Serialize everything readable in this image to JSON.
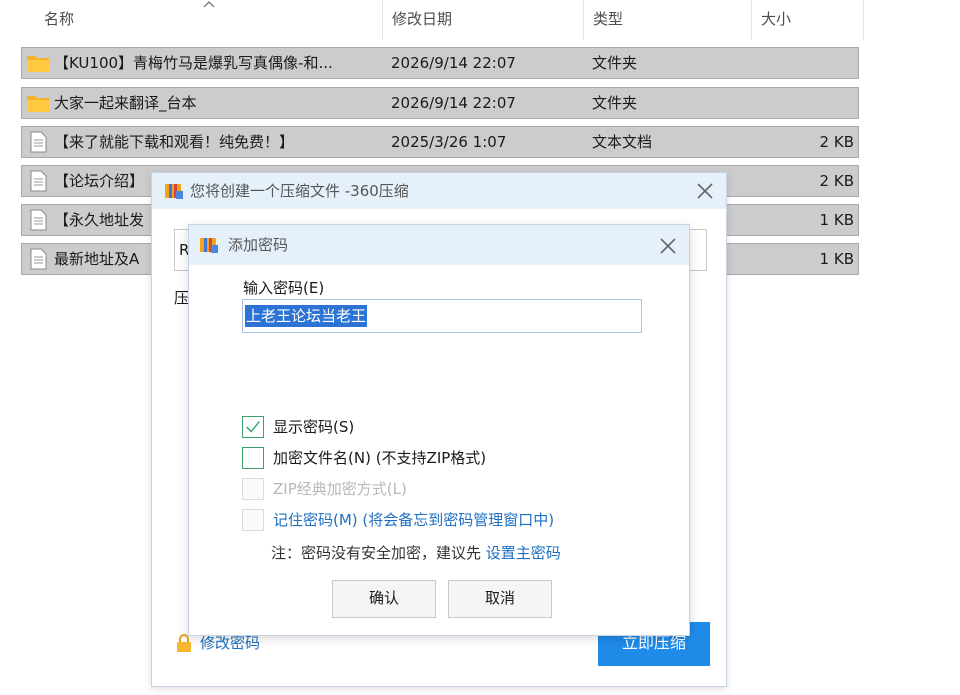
{
  "explorer": {
    "columns": [
      {
        "label": "名称"
      },
      {
        "label": "修改日期"
      },
      {
        "label": "类型"
      },
      {
        "label": "大小"
      }
    ],
    "rows": [
      {
        "icon": "folder-icon",
        "name": "【KU100】青梅竹马是爆乳写真偶像-和...",
        "date": "2026/9/14 22:07",
        "type": "文件夹",
        "size": ""
      },
      {
        "icon": "folder-icon",
        "name": "大家一起来翻译_台本",
        "date": "2026/9/14 22:07",
        "type": "文件夹",
        "size": ""
      },
      {
        "icon": "text-file-icon",
        "name": "【来了就能下载和观看！纯免费！】",
        "date": "2025/3/26 1:07",
        "type": "文本文档",
        "size": "2 KB"
      },
      {
        "icon": "text-file-icon",
        "name": "【论坛介绍】",
        "date": "",
        "type": "",
        "size": "2 KB"
      },
      {
        "icon": "text-file-icon",
        "name": "【永久地址发",
        "date": "",
        "type": "",
        "size": "1 KB"
      },
      {
        "icon": "text-file-icon",
        "name": "最新地址及A",
        "date": "",
        "type": "",
        "size": "1 KB"
      }
    ]
  },
  "outer_dialog": {
    "title": "您将创建一个压缩文件 -360压缩",
    "path_value": "R",
    "label": "压",
    "edit_password": "修改密码",
    "compress_button": "立即压缩"
  },
  "inner_dialog": {
    "title": "添加密码",
    "password_label": "输入密码(E)",
    "password_value": "上老王论坛当老王",
    "options": [
      {
        "label": "显示密码(S)",
        "checked": true,
        "enabled": true
      },
      {
        "label": "加密文件名(N) (不支持ZIP格式)",
        "checked": false,
        "enabled": true
      },
      {
        "label": "ZIP经典加密方式(L)",
        "checked": false,
        "enabled": false
      },
      {
        "label": "记住密码(M) (将会备忘到密码管理窗口中)",
        "checked": false,
        "enabled": true
      }
    ],
    "note_text": "注：密码没有安全加密，建议先 ",
    "note_link": "设置主密码",
    "ok_button": "确认",
    "cancel_button": "取消"
  },
  "colors": {
    "selection_row": "#cccccc",
    "dialog_title_bg": "#e6f0fb",
    "primary_button": "#1f8be9",
    "link": "#1e6fc2",
    "checkbox_border": "#3aa36b"
  }
}
